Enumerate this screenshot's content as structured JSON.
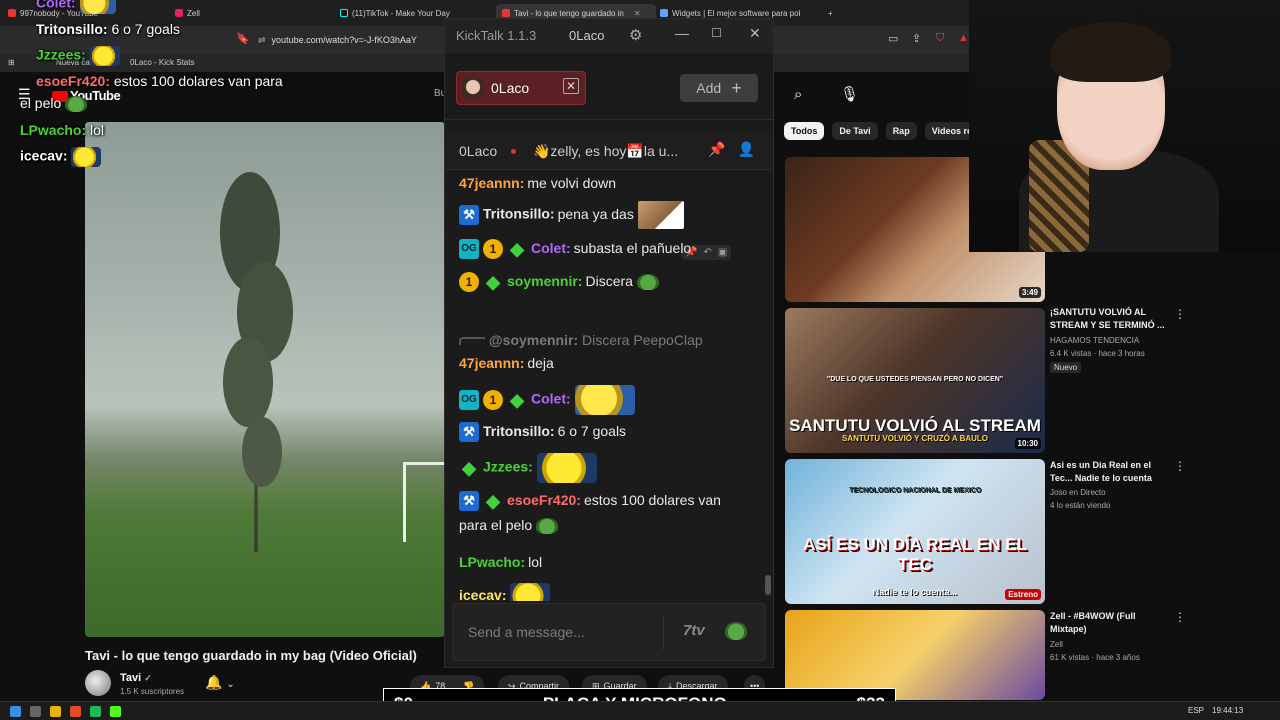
{
  "browser": {
    "tabs": [
      {
        "label": "997nobody - YouTube"
      },
      {
        "label": "Zell"
      },
      {
        "label": "(11)TikTok - Make Your Day"
      },
      {
        "label": "Tavi - lo que tengo guardado in"
      },
      {
        "label": "Widgets | El mejor software para pol"
      }
    ],
    "new_tab": "+",
    "url": "youtube.com/watch?v=-J-fKO3hAaY",
    "bookmarks": [
      {
        "label": "Nueva ca"
      },
      {
        "label": "0Laco - Kick Stats"
      }
    ]
  },
  "youtube": {
    "logo": "YouTube",
    "search_btn_letter": "Bu",
    "video_title": "Tavi - lo que tengo guardado in my bag (Video Oficial)",
    "channel": "Tavi",
    "subscribers": "1.5 K suscriptores",
    "likes": "78",
    "actions": {
      "share": "Compartir",
      "save": "Guardar",
      "download": "Descargar",
      "more": "•••"
    },
    "chips": [
      "Todos",
      "De Tavi",
      "Rap",
      "Videos re"
    ],
    "recommendations": [
      {
        "duration": "3:49"
      },
      {
        "title": "¡SANTUTU VOLVIÓ AL STREAM Y SE TERMINÓ ...",
        "channel": "HAGAMOS TENDENCIA",
        "meta": "6.4 K vistas · hace 3 horas",
        "badge": "Nuevo",
        "duration": "10:30",
        "thumb_text": "SANTUTU VOLVIÓ AL STREAM",
        "thumb_sub": "SANTUTU VOLVIÓ Y CRUZÓ A BAULO",
        "thumb_quote": "\"DUE LO QUE USTEDES PIENSAN PERO NO DICEN\""
      },
      {
        "title": "Asi es un Dia Real en el Tec... Nadie te lo cuenta",
        "channel": "Joso en Directo",
        "meta": "4 lo están viendo",
        "thumb_text": "ASÍ ES UN DÍA REAL EN EL TEC",
        "thumb_sub": "Nadie te lo cuenta...",
        "thumb_badge": "Estreno",
        "thumb_school": "TECNOLOGICO NACIONAL DE MEXICO"
      },
      {
        "title": "Zell - #B4WOW (Full Mixtape)",
        "channel": "Zell",
        "meta": "61 K vistas · hace 3 años"
      }
    ]
  },
  "overlay_chat": [
    {
      "user": "Colet:",
      "color": "#b566ff",
      "msg": ""
    },
    {
      "user": "Tritonsillo:",
      "color": "#ffffff",
      "msg": "6 o 7 goals"
    },
    {
      "user": "Jzzees:",
      "color": "#4cd137",
      "msg": ""
    },
    {
      "user": "esoeFr420:",
      "color": "#ff6b6b",
      "msg": "estos 100 dolares van para"
    },
    {
      "user": "",
      "color": "#ffffff",
      "msg": "el pelo"
    },
    {
      "user": "LPwacho:",
      "color": "#4cd137",
      "msg": "lol"
    },
    {
      "user": "icecav:",
      "color": "#ffffff",
      "msg": ""
    }
  ],
  "kicktalk": {
    "app_title": "KickTalk 1.1.3",
    "username": "0Laco",
    "tab_label": "0Laco",
    "add_label": "Add",
    "channel_name": "0Laco",
    "topic": "👋zelly, es hoy📅la u...",
    "input_placeholder": "Send a message...",
    "seven_tv": "7tv",
    "messages": [
      {
        "user": "47jeannn:",
        "color": "#ffa63d",
        "msg": "me volvi down",
        "badges": ""
      },
      {
        "user": "Tritonsillo:",
        "color": "#ffffff",
        "msg": "pena ya das",
        "badges": "mod"
      },
      {
        "user": "Colet:",
        "color": "#b566ff",
        "msg": "subasta el pañuelo",
        "badges": "og,sub,vip"
      },
      {
        "user": "soymennir:",
        "color": "#4cd137",
        "msg": "Discera",
        "badges": "sub,vip"
      },
      {
        "user": "47jeannn:",
        "color": "#ffa63d",
        "msg": "deja",
        "badges": ""
      },
      {
        "user": "Colet:",
        "color": "#b566ff",
        "msg": "",
        "badges": "og,sub,vip"
      },
      {
        "user": "Tritonsillo:",
        "color": "#ffffff",
        "msg": "6 o 7 goals",
        "badges": "mod"
      },
      {
        "user": "Jzzees:",
        "color": "#4cd137",
        "msg": "",
        "badges": "vip"
      },
      {
        "user": "esoeFr420:",
        "color": "#ff6b6b",
        "msg": "estos 100 dolares van",
        "badges": "mod,vip"
      },
      {
        "user": "",
        "color": "#e9e9e9",
        "msg": "para el pelo",
        "badges": ""
      },
      {
        "user": "LPwacho:",
        "color": "#4cd137",
        "msg": "lol",
        "badges": ""
      },
      {
        "user": "icecav:",
        "color": "#ffe45c",
        "msg": "",
        "badges": ""
      }
    ],
    "reply": {
      "mention": "@soymennir:",
      "text": "Discera PeepoClap"
    },
    "badge_labels": {
      "og": "OG",
      "sub": "1",
      "mod": "⚒",
      "vip": "◆"
    }
  },
  "goal_bar": {
    "left": "$0",
    "title": "PLACA Y MICROFONO",
    "right": "$33"
  },
  "taskbar": {
    "lang": "ESP",
    "time": "19:44:13"
  },
  "colors": {
    "kick_green": "#53fc18",
    "kt_tab_red": "#5c1f24"
  }
}
